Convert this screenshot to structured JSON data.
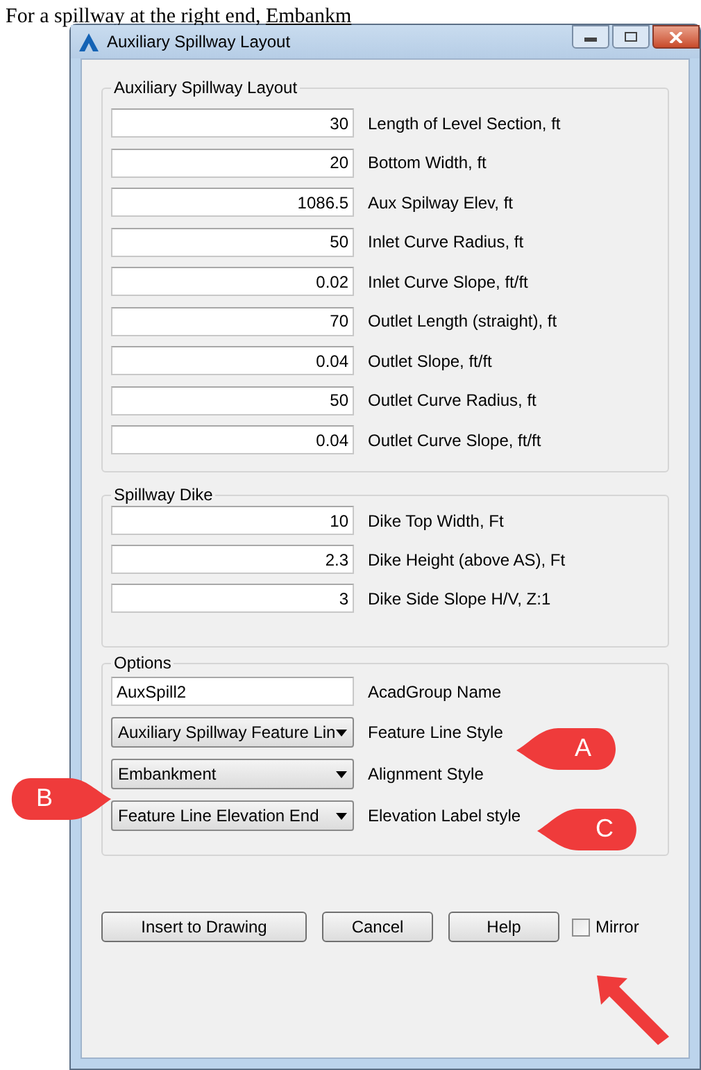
{
  "document_text": {
    "text": "For a spillway at the right end,",
    "link": "Embankm"
  },
  "window": {
    "title": "Auxiliary Spillway Layout"
  },
  "groups": [
    {
      "title": "Auxiliary Spillway Layout",
      "fields": [
        {
          "kind": "number",
          "value": "30",
          "label": "Length of Level Section, ft"
        },
        {
          "kind": "number",
          "value": "20",
          "label": "Bottom Width, ft"
        },
        {
          "kind": "number",
          "value": "1086.5",
          "label": "Aux Spilway Elev, ft"
        },
        {
          "kind": "number",
          "value": "50",
          "label": "Inlet Curve Radius, ft"
        },
        {
          "kind": "number",
          "value": "0.02",
          "label": "Inlet Curve Slope, ft/ft"
        },
        {
          "kind": "number",
          "value": "70",
          "label": "Outlet Length (straight), ft"
        },
        {
          "kind": "number",
          "value": "0.04",
          "label": "Outlet Slope, ft/ft"
        },
        {
          "kind": "number",
          "value": "50",
          "label": "Outlet Curve Radius, ft"
        },
        {
          "kind": "number",
          "value": "0.04",
          "label": "Outlet Curve Slope, ft/ft"
        }
      ]
    },
    {
      "title": "Spillway Dike",
      "fields": [
        {
          "kind": "number",
          "value": "10",
          "label": "Dike Top Width, Ft"
        },
        {
          "kind": "number",
          "value": "2.3",
          "label": "Dike Height (above AS), Ft"
        },
        {
          "kind": "number",
          "value": "3",
          "label": "Dike Side Slope H/V, Z:1"
        }
      ]
    },
    {
      "title": "Options",
      "fields": [
        {
          "kind": "text",
          "value": "AuxSpill2",
          "label": "AcadGroup Name"
        },
        {
          "kind": "dropdown",
          "value": "Auxiliary Spillway Feature Lin",
          "label": "Feature Line Style"
        },
        {
          "kind": "dropdown",
          "value": "Embankment",
          "label": "Alignment Style"
        },
        {
          "kind": "dropdown",
          "value": "Feature Line Elevation End",
          "label": "Elevation Label style"
        }
      ]
    }
  ],
  "buttons": [
    "Insert to Drawing",
    "Cancel",
    "Help"
  ],
  "mirror": {
    "label": "Mirror",
    "checked": false
  },
  "callouts": [
    {
      "label": "A",
      "kind": "point-left"
    },
    {
      "label": "B",
      "kind": "point-right"
    },
    {
      "label": "C",
      "kind": "point-left"
    }
  ]
}
